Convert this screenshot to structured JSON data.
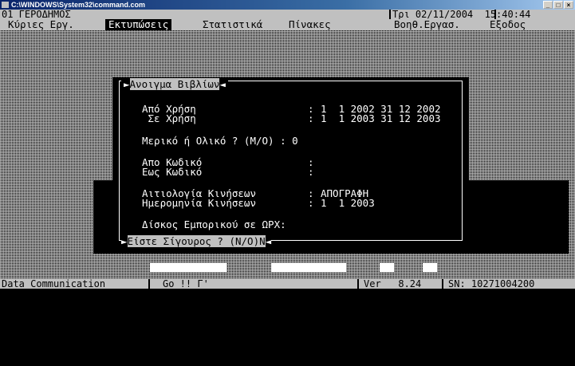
{
  "window": {
    "title": "C:\\WINDOWS\\System32\\command.com",
    "buttons": [
      "_",
      "□",
      "×"
    ]
  },
  "topline": {
    "company": "01 ΓΕΡΟΔΗΜΟΣ",
    "datetime": "Τρι 02/11/2004  15:40:44"
  },
  "menu": [
    "Κύριες Εργ.",
    "Εκτυπώσεις",
    "Στατιστικά",
    "Πίνακες",
    "Βοηθ.Εργασ.",
    "Εξοδος"
  ],
  "menu_active_index": 1,
  "dialog": {
    "title": "Ανοιγμα Βιβλίων",
    "rows": [
      {
        "label": "Από Χρήση",
        "value": "1  1 2002 31 12 2002"
      },
      {
        "label": " Σε Χρήση",
        "value": "1  1 2003 31 12 2003"
      },
      {
        "label": "Μερικό ή Ολικό ? (Μ/Ο) : 0",
        "value": ""
      },
      {
        "label": "Απο Κωδικό",
        "value": ""
      },
      {
        "label": "Εως Κωδικό",
        "value": ""
      },
      {
        "label": "Αιτιολογία Κινήσεων",
        "value": "ΑΠΟΓΡΑΦΗ"
      },
      {
        "label": "Ημερομηνία Κινήσεων",
        "value": "1  1 2003"
      },
      {
        "label": "Δίσκος Εμπορικού σε ΩΡΧ:",
        "value": ""
      }
    ],
    "confirm": "Είστε Σίγουρος ? (Ν/Ο)",
    "confirm_value": "Ν"
  },
  "status": {
    "left": "Data Communication",
    "middle": "Go !! Γ'",
    "version": "Ver   8.24",
    "serial": "SN: 10271004200"
  }
}
